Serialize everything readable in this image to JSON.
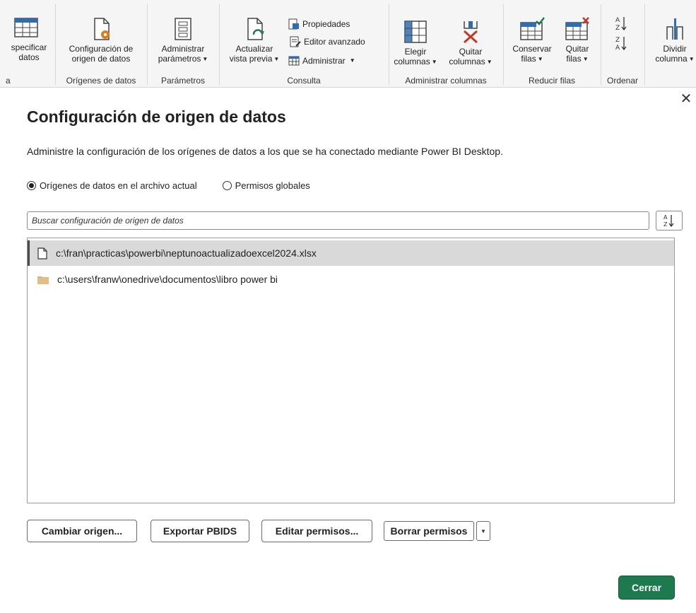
{
  "ribbon": {
    "buttons": {
      "specify": {
        "line1": "specificar",
        "line2": "datos"
      },
      "ds_settings": {
        "line1": "Configuración de",
        "line2": "origen de datos"
      },
      "manage_params": {
        "line1": "Administrar",
        "line2": "parámetros"
      },
      "refresh_preview": {
        "line1": "Actualizar",
        "line2": "vista previa"
      },
      "properties": "Propiedades",
      "advanced_editor": "Editor avanzado",
      "manage": "Administrar",
      "choose_columns": {
        "line1": "Elegir",
        "line2": "columnas"
      },
      "remove_columns": {
        "line1": "Quitar",
        "line2": "columnas"
      },
      "keep_rows": {
        "line1": "Conservar",
        "line2": "filas"
      },
      "remove_rows": {
        "line1": "Quitar",
        "line2": "filas"
      },
      "split_column": {
        "line1": "Dividir",
        "line2": "columna"
      }
    },
    "groups": {
      "left_cut": "a",
      "data_sources": "Orígenes de datos",
      "parameters": "Parámetros",
      "query": "Consulta",
      "manage_columns": "Administrar columnas",
      "reduce_rows": "Reducir filas",
      "sort": "Ordenar"
    }
  },
  "dialog": {
    "close_glyph": "✕",
    "title": "Configuración de origen de datos",
    "description": "Administre la configuración de los orígenes de datos a los que se ha conectado mediante Power BI Desktop.",
    "radio_current": "Orígenes de datos en el archivo actual",
    "radio_global": "Permisos globales",
    "selected_scope": "current",
    "search_placeholder": "Buscar configuración de origen de datos",
    "search_value": "",
    "sources": [
      {
        "path": "c:\\fran\\practicas\\powerbi\\neptunoactualizadoexcel2024.xlsx",
        "icon": "file-icon",
        "selected": true
      },
      {
        "path": "c:\\users\\franw\\onedrive\\documentos\\libro power bi",
        "icon": "folder-icon",
        "selected": false
      }
    ],
    "buttons": {
      "change_source": "Cambiar origen...",
      "export_pbids": "Exportar PBIDS",
      "edit_permissions": "Editar permisos...",
      "clear_permissions": "Borrar permisos",
      "close": "Cerrar"
    }
  },
  "colors": {
    "primary_button": "#1d7a4f",
    "selected_row": "#d9d9d9",
    "folder": "#d8b07a"
  }
}
